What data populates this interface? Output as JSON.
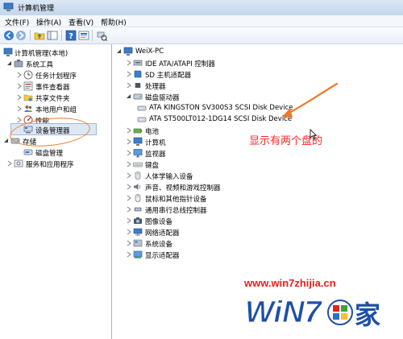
{
  "window": {
    "title": "计算机管理"
  },
  "menu": {
    "items": [
      "文件(F)",
      "操作(A)",
      "查看(V)",
      "帮助(H)"
    ]
  },
  "toolbar": {
    "buttons": [
      "back-arrow-icon",
      "forward-arrow-icon",
      "folder-up-icon",
      "console-icon",
      "help-icon",
      "properties-icon",
      "device-scan-icon"
    ]
  },
  "left_tree": {
    "root": "计算机管理(本地)",
    "system_tools": "系统工具",
    "task_scheduler": "任务计划程序",
    "event_viewer": "事件查看器",
    "shared_folders": "共享文件夹",
    "local_users": "本地用户和组",
    "performance": "性能",
    "device_manager": "设备管理器",
    "storage": "存储",
    "disk_management": "磁盘管理",
    "services_apps": "服务和应用程序"
  },
  "device_tree": {
    "computer_name": "WeiX-PC",
    "categories": [
      "IDE ATA/ATAPI 控制器",
      "SD 主机适配器",
      "处理器",
      "磁盘驱动器"
    ],
    "disk_children": [
      "ATA KINGSTON SV300S3 SCSI Disk Device",
      "ATA ST500LT012-1DG14 SCSI Disk Device"
    ],
    "more_categories": [
      "电池",
      "计算机",
      "监视器",
      "键盘",
      "人体学输入设备",
      "声音、视频和游戏控制器",
      "鼠标和其他指针设备",
      "通用串行总线控制器",
      "图像设备",
      "网络适配器",
      "系统设备",
      "显示适配器"
    ]
  },
  "annotation": {
    "text": "显示有两个盘的"
  },
  "watermark": {
    "url": "www.win7zhijia.cn",
    "logo_text": "WiN7",
    "logo_suffix": "家"
  },
  "colors": {
    "annotation_red": "#ff2626",
    "arrow_orange": "#f07a2a",
    "watermark_red": "#e8201c",
    "logo_blue": "#1d4fa8"
  }
}
